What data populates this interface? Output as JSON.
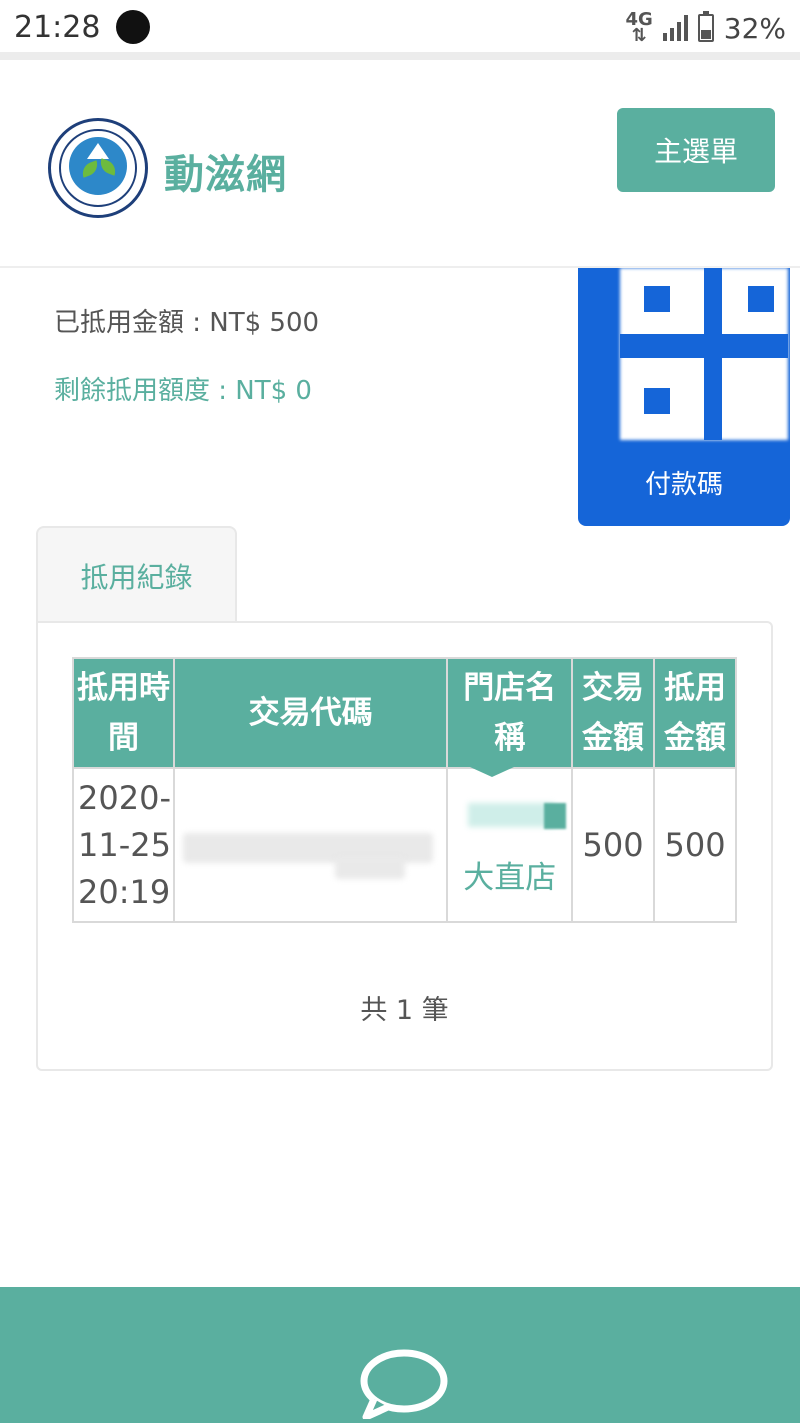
{
  "status_bar": {
    "time": "21:28",
    "network": "4G",
    "battery": "32%"
  },
  "header": {
    "brand": "動滋網",
    "menu_button": "主選單",
    "logo_icon": "ministry-of-education-seal"
  },
  "summary": {
    "used_amount": "已抵用金額 : NT$ 500",
    "remaining_amount": "剩餘抵用額度 : NT$ 0"
  },
  "payment_code": {
    "label": "付款碼",
    "icon": "qr-code-icon"
  },
  "tabs": [
    {
      "label": "抵用紀錄"
    }
  ],
  "table": {
    "headers": [
      "抵用時間",
      "交易代碼",
      "門店名稱",
      "交易金額",
      "抵用金額"
    ],
    "rows": [
      {
        "time": "2020-11-25 20:19",
        "code": "",
        "store": "大直店",
        "amount": "500",
        "used": "500"
      }
    ]
  },
  "total": "共 1 筆",
  "footer": {
    "icon": "chat-bubble-icon"
  },
  "colors": {
    "brand": "#5aaf9f",
    "qr_blue": "#1565d8"
  }
}
